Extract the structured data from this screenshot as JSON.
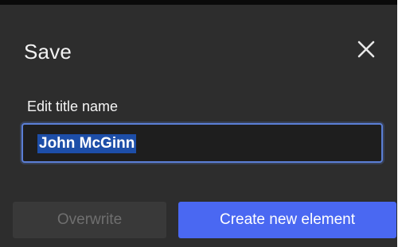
{
  "dialog": {
    "title": "Save",
    "close_icon": "close-icon",
    "field_label": "Edit title name",
    "field_value": "John McGinn",
    "buttons": {
      "overwrite": "Overwrite",
      "create": "Create new element"
    }
  },
  "colors": {
    "background": "#2d2d2d",
    "field_border": "#5b7fd6",
    "selection": "#1d4ea8",
    "primary_button": "#4a68f2",
    "disabled_button": "#393939",
    "disabled_text": "#6f6f6f"
  }
}
